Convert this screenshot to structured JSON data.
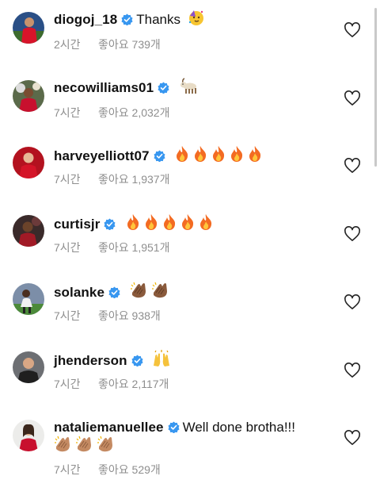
{
  "comments": [
    {
      "username": "diogoj_18",
      "text": "Thanks",
      "emojis": [
        "partying-face"
      ],
      "time": "2시간",
      "likes": "좋아요 739개"
    },
    {
      "username": "necowilliams01",
      "text": "",
      "emojis": [
        "goat"
      ],
      "time": "7시간",
      "likes": "좋아요 2,032개"
    },
    {
      "username": "harveyelliott07",
      "text": "",
      "emojis": [
        "fire",
        "fire",
        "fire",
        "fire",
        "fire"
      ],
      "time": "7시간",
      "likes": "좋아요 1,937개"
    },
    {
      "username": "curtisjr",
      "text": "",
      "emojis": [
        "fire",
        "fire",
        "fire",
        "fire",
        "fire"
      ],
      "time": "7시간",
      "likes": "좋아요 1,951개"
    },
    {
      "username": "solanke",
      "text": "",
      "emojis": [
        "clapping-hands",
        "clapping-hands"
      ],
      "time": "7시간",
      "likes": "좋아요 938개"
    },
    {
      "username": "jhenderson",
      "text": "",
      "emojis": [
        "raising-hands"
      ],
      "time": "7시간",
      "likes": "좋아요 2,117개"
    },
    {
      "username": "nataliemanuellee",
      "text": "Well done brotha!!!",
      "emojis": [
        "clapping-hands",
        "clapping-hands",
        "clapping-hands"
      ],
      "time": "7시간",
      "likes": "좋아요 529개"
    }
  ],
  "colors": {
    "verified": "#3897f0",
    "meta": "#8e8e8e",
    "username": "#111111"
  }
}
